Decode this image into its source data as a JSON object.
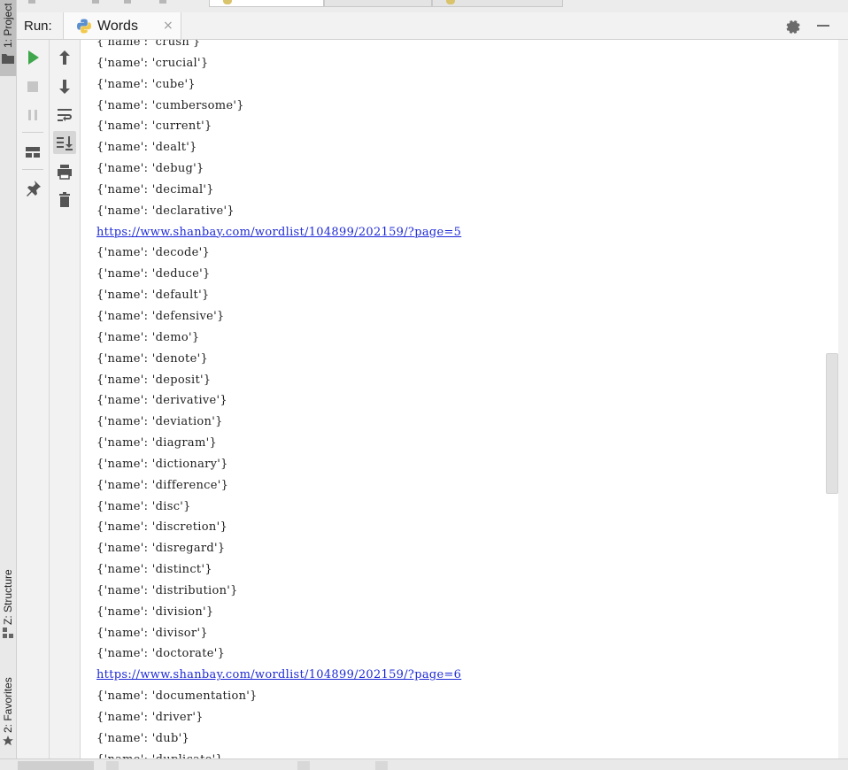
{
  "left_stripe": {
    "project_label": "1: Project",
    "structure_label": "Z: Structure",
    "favorites_label": "2: Favorites"
  },
  "run_panel": {
    "label": "Run:",
    "tab_title": "Words",
    "tab_icon": "python-icon",
    "close_glyph": "×",
    "header_icons": [
      "gear-icon",
      "minimize-icon"
    ]
  },
  "toolbar": {
    "left": [
      "run-icon",
      "stop-icon",
      "pause-icon",
      "layout-icon",
      "pin-icon"
    ],
    "right": [
      "up-arrow-icon",
      "down-arrow-icon",
      "soft-wrap-icon",
      "scroll-to-end-icon",
      "print-icon",
      "trash-icon"
    ]
  },
  "colors": {
    "run_green": "#3fa64b",
    "link_blue": "#1f2bd6",
    "console_text": "#1e1e1e"
  },
  "console": {
    "lines": [
      {
        "text": "{'name': 'crush'}",
        "type": "text"
      },
      {
        "text": "{'name': 'crucial'}",
        "type": "text"
      },
      {
        "text": "{'name': 'cube'}",
        "type": "text"
      },
      {
        "text": "{'name': 'cumbersome'}",
        "type": "text"
      },
      {
        "text": "{'name': 'current'}",
        "type": "text"
      },
      {
        "text": "{'name': 'dealt'}",
        "type": "text"
      },
      {
        "text": "{'name': 'debug'}",
        "type": "text"
      },
      {
        "text": "{'name': 'decimal'}",
        "type": "text"
      },
      {
        "text": "{'name': 'declarative'}",
        "type": "text"
      },
      {
        "text": "https://www.shanbay.com/wordlist/104899/202159/?page=5",
        "type": "link"
      },
      {
        "text": "{'name': 'decode'}",
        "type": "text"
      },
      {
        "text": "{'name': 'deduce'}",
        "type": "text"
      },
      {
        "text": "{'name': 'default'}",
        "type": "text"
      },
      {
        "text": "{'name': 'defensive'}",
        "type": "text"
      },
      {
        "text": "{'name': 'demo'}",
        "type": "text"
      },
      {
        "text": "{'name': 'denote'}",
        "type": "text"
      },
      {
        "text": "{'name': 'deposit'}",
        "type": "text"
      },
      {
        "text": "{'name': 'derivative'}",
        "type": "text"
      },
      {
        "text": "{'name': 'deviation'}",
        "type": "text"
      },
      {
        "text": "{'name': 'diagram'}",
        "type": "text"
      },
      {
        "text": "{'name': 'dictionary'}",
        "type": "text"
      },
      {
        "text": "{'name': 'difference'}",
        "type": "text"
      },
      {
        "text": "{'name': 'disc'}",
        "type": "text"
      },
      {
        "text": "{'name': 'discretion'}",
        "type": "text"
      },
      {
        "text": "{'name': 'disregard'}",
        "type": "text"
      },
      {
        "text": "{'name': 'distinct'}",
        "type": "text"
      },
      {
        "text": "{'name': 'distribution'}",
        "type": "text"
      },
      {
        "text": "{'name': 'division'}",
        "type": "text"
      },
      {
        "text": "{'name': 'divisor'}",
        "type": "text"
      },
      {
        "text": "{'name': 'doctorate'}",
        "type": "text"
      },
      {
        "text": "https://www.shanbay.com/wordlist/104899/202159/?page=6",
        "type": "link"
      },
      {
        "text": "{'name': 'documentation'}",
        "type": "text"
      },
      {
        "text": "{'name': 'driver'}",
        "type": "text"
      },
      {
        "text": "{'name': 'dub'}",
        "type": "text"
      },
      {
        "text": "{'name': 'duplicate'}",
        "type": "text"
      }
    ]
  }
}
